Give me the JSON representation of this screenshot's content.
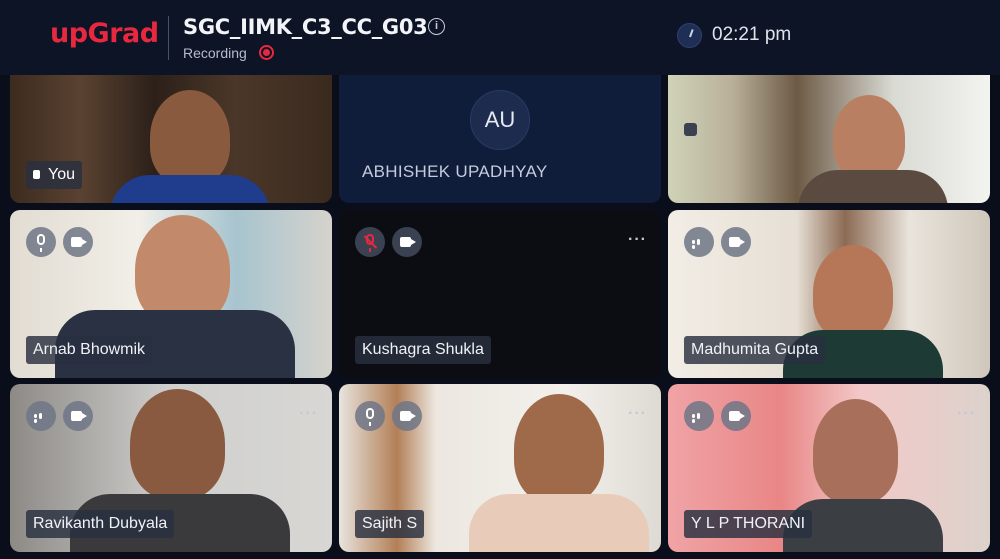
{
  "header": {
    "brand": "upGrad",
    "meeting_title": "SGC_IIMK_C3_CC_G03",
    "recording_label": "Recording",
    "time": "02:21 pm"
  },
  "tiles": [
    {
      "name": "You",
      "has_video": true
    },
    {
      "name": "ABHISHEK UPADHYAY",
      "initials": "AU",
      "has_video": false
    },
    {
      "name": "",
      "has_video": true
    },
    {
      "name": "Arnab Bhowmik",
      "mic": "on",
      "camera": "on",
      "has_video": true
    },
    {
      "name": "Kushagra Shukla",
      "mic": "muted",
      "camera": "on",
      "has_video": false
    },
    {
      "name": "Madhumita Gupta",
      "mic": "speaking",
      "camera": "on",
      "has_video": true
    },
    {
      "name": "Ravikanth Dubyala",
      "mic": "speaking",
      "camera": "on",
      "has_video": true
    },
    {
      "name": "Sajith S",
      "mic": "on",
      "camera": "on",
      "has_video": true
    },
    {
      "name": "Y L P THORANI",
      "mic": "speaking",
      "camera": "on",
      "has_video": true
    }
  ],
  "colors": {
    "brand": "#e8283f",
    "header_bg": "#0d1426",
    "page_bg": "#0a0e1a"
  }
}
